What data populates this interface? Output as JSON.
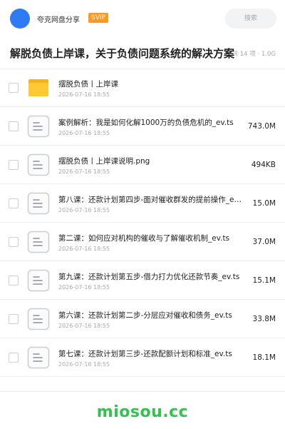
{
  "header": {
    "app_name": "夸克网盘分享",
    "badge": "SVIP",
    "search_label": "搜索"
  },
  "share": {
    "title": "解脱负债上岸课，关于负债问题系统的解决方案",
    "meta": "共 14 项 · 1.0G"
  },
  "files": [
    {
      "name": "摆脱负债丨上岸课",
      "date": "2026-07-16 18:55",
      "size": "",
      "type": "folder"
    },
    {
      "name": "案例解析：我是如何化解1000万的负债危机的_ev.ts",
      "date": "2026-07-16 18:55",
      "size": "743.0M",
      "type": "file"
    },
    {
      "name": "摆脱负债丨上岸课说明.png",
      "date": "2026-07-16 18:55",
      "size": "494KB",
      "type": "file"
    },
    {
      "name": "第八课：还款计划第四步-面对催收群发的提前操作_ev.ts",
      "date": "2026-07-16 18:55",
      "size": "15.0M",
      "type": "file"
    },
    {
      "name": "第二课：如何应对机构的催收与了解催收机制_ev.ts",
      "date": "2026-07-16 18:55",
      "size": "37.0M",
      "type": "file"
    },
    {
      "name": "第九课：还款计划第五步-借力打力优化还款节奏_ev.ts",
      "date": "2026-07-16 18:55",
      "size": "15.1M",
      "type": "file"
    },
    {
      "name": "第六课：还款计划第二步-分层应对催收和债务_ev.ts",
      "date": "2026-07-16 18:55",
      "size": "33.8M",
      "type": "file"
    },
    {
      "name": "第七课：还款计划第三步-还款配额计划和标准_ev.ts",
      "date": "2026-07-16 18:55",
      "size": "18.1M",
      "type": "file"
    }
  ],
  "footer": {
    "brand": "miosou.cc"
  },
  "colors": {
    "avatar": "#2f7bf5",
    "badge": "#ff9a1f",
    "brand": "#32c24d",
    "folder": "#ffc933",
    "folder_tab": "#f5b416",
    "file_icon_border": "#c9ced6",
    "file_icon_lines": "#8a929e"
  }
}
